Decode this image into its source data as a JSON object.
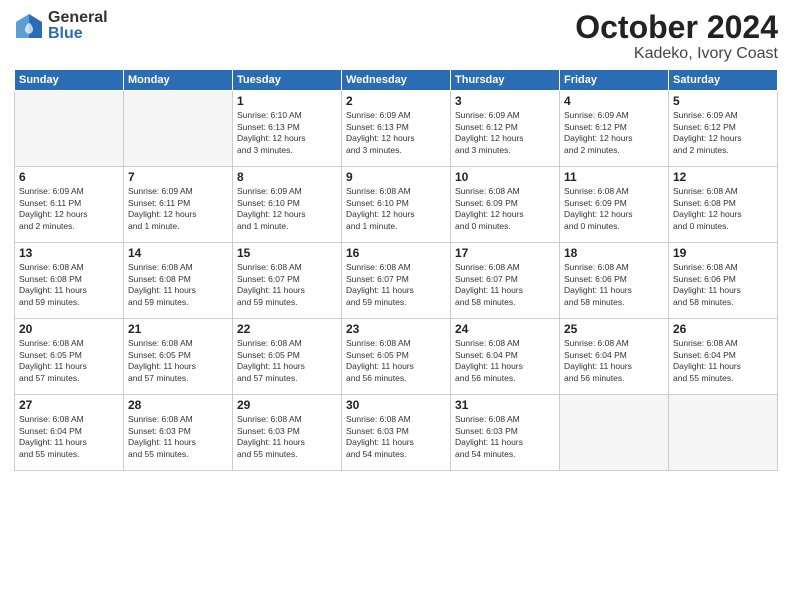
{
  "logo": {
    "general": "General",
    "blue": "Blue"
  },
  "header": {
    "month": "October 2024",
    "location": "Kadeko, Ivory Coast"
  },
  "weekdays": [
    "Sunday",
    "Monday",
    "Tuesday",
    "Wednesday",
    "Thursday",
    "Friday",
    "Saturday"
  ],
  "weeks": [
    [
      {
        "day": "",
        "info": "",
        "empty": true
      },
      {
        "day": "",
        "info": "",
        "empty": true
      },
      {
        "day": "1",
        "info": "Sunrise: 6:10 AM\nSunset: 6:13 PM\nDaylight: 12 hours\nand 3 minutes."
      },
      {
        "day": "2",
        "info": "Sunrise: 6:09 AM\nSunset: 6:13 PM\nDaylight: 12 hours\nand 3 minutes."
      },
      {
        "day": "3",
        "info": "Sunrise: 6:09 AM\nSunset: 6:12 PM\nDaylight: 12 hours\nand 3 minutes."
      },
      {
        "day": "4",
        "info": "Sunrise: 6:09 AM\nSunset: 6:12 PM\nDaylight: 12 hours\nand 2 minutes."
      },
      {
        "day": "5",
        "info": "Sunrise: 6:09 AM\nSunset: 6:12 PM\nDaylight: 12 hours\nand 2 minutes."
      }
    ],
    [
      {
        "day": "6",
        "info": "Sunrise: 6:09 AM\nSunset: 6:11 PM\nDaylight: 12 hours\nand 2 minutes."
      },
      {
        "day": "7",
        "info": "Sunrise: 6:09 AM\nSunset: 6:11 PM\nDaylight: 12 hours\nand 1 minute."
      },
      {
        "day": "8",
        "info": "Sunrise: 6:09 AM\nSunset: 6:10 PM\nDaylight: 12 hours\nand 1 minute."
      },
      {
        "day": "9",
        "info": "Sunrise: 6:08 AM\nSunset: 6:10 PM\nDaylight: 12 hours\nand 1 minute."
      },
      {
        "day": "10",
        "info": "Sunrise: 6:08 AM\nSunset: 6:09 PM\nDaylight: 12 hours\nand 0 minutes."
      },
      {
        "day": "11",
        "info": "Sunrise: 6:08 AM\nSunset: 6:09 PM\nDaylight: 12 hours\nand 0 minutes."
      },
      {
        "day": "12",
        "info": "Sunrise: 6:08 AM\nSunset: 6:08 PM\nDaylight: 12 hours\nand 0 minutes."
      }
    ],
    [
      {
        "day": "13",
        "info": "Sunrise: 6:08 AM\nSunset: 6:08 PM\nDaylight: 11 hours\nand 59 minutes."
      },
      {
        "day": "14",
        "info": "Sunrise: 6:08 AM\nSunset: 6:08 PM\nDaylight: 11 hours\nand 59 minutes."
      },
      {
        "day": "15",
        "info": "Sunrise: 6:08 AM\nSunset: 6:07 PM\nDaylight: 11 hours\nand 59 minutes."
      },
      {
        "day": "16",
        "info": "Sunrise: 6:08 AM\nSunset: 6:07 PM\nDaylight: 11 hours\nand 59 minutes."
      },
      {
        "day": "17",
        "info": "Sunrise: 6:08 AM\nSunset: 6:07 PM\nDaylight: 11 hours\nand 58 minutes."
      },
      {
        "day": "18",
        "info": "Sunrise: 6:08 AM\nSunset: 6:06 PM\nDaylight: 11 hours\nand 58 minutes."
      },
      {
        "day": "19",
        "info": "Sunrise: 6:08 AM\nSunset: 6:06 PM\nDaylight: 11 hours\nand 58 minutes."
      }
    ],
    [
      {
        "day": "20",
        "info": "Sunrise: 6:08 AM\nSunset: 6:05 PM\nDaylight: 11 hours\nand 57 minutes."
      },
      {
        "day": "21",
        "info": "Sunrise: 6:08 AM\nSunset: 6:05 PM\nDaylight: 11 hours\nand 57 minutes."
      },
      {
        "day": "22",
        "info": "Sunrise: 6:08 AM\nSunset: 6:05 PM\nDaylight: 11 hours\nand 57 minutes."
      },
      {
        "day": "23",
        "info": "Sunrise: 6:08 AM\nSunset: 6:05 PM\nDaylight: 11 hours\nand 56 minutes."
      },
      {
        "day": "24",
        "info": "Sunrise: 6:08 AM\nSunset: 6:04 PM\nDaylight: 11 hours\nand 56 minutes."
      },
      {
        "day": "25",
        "info": "Sunrise: 6:08 AM\nSunset: 6:04 PM\nDaylight: 11 hours\nand 56 minutes."
      },
      {
        "day": "26",
        "info": "Sunrise: 6:08 AM\nSunset: 6:04 PM\nDaylight: 11 hours\nand 55 minutes."
      }
    ],
    [
      {
        "day": "27",
        "info": "Sunrise: 6:08 AM\nSunset: 6:04 PM\nDaylight: 11 hours\nand 55 minutes."
      },
      {
        "day": "28",
        "info": "Sunrise: 6:08 AM\nSunset: 6:03 PM\nDaylight: 11 hours\nand 55 minutes."
      },
      {
        "day": "29",
        "info": "Sunrise: 6:08 AM\nSunset: 6:03 PM\nDaylight: 11 hours\nand 55 minutes."
      },
      {
        "day": "30",
        "info": "Sunrise: 6:08 AM\nSunset: 6:03 PM\nDaylight: 11 hours\nand 54 minutes."
      },
      {
        "day": "31",
        "info": "Sunrise: 6:08 AM\nSunset: 6:03 PM\nDaylight: 11 hours\nand 54 minutes."
      },
      {
        "day": "",
        "info": "",
        "empty": true
      },
      {
        "day": "",
        "info": "",
        "empty": true
      }
    ]
  ]
}
